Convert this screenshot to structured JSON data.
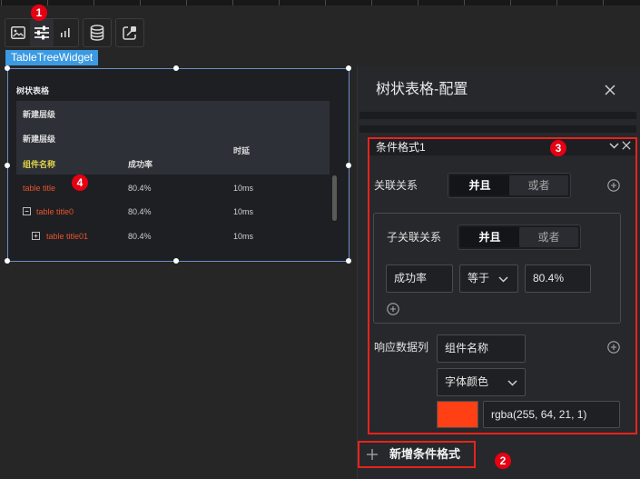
{
  "toolbar": {
    "tools": [
      {
        "icon": "image-icon",
        "active": false
      },
      {
        "icon": "sliders-icon",
        "active": true
      },
      {
        "icon": "bar-chart-icon",
        "active": false
      },
      {
        "icon": "database-icon",
        "active": false
      },
      {
        "icon": "data-link-icon",
        "active": false
      }
    ]
  },
  "markers": [
    "1",
    "2",
    "3",
    "4"
  ],
  "widget": {
    "type_tag": "TableTreeWidget",
    "title": "树状表格",
    "levels": [
      "新建层级",
      "新建层级"
    ],
    "columns": {
      "name": "组件名称",
      "rate": "成功率",
      "latency": "时延"
    },
    "rows": [
      {
        "name": "table title",
        "rate": "80.4%",
        "latency": "10ms",
        "toggle_icon": null
      },
      {
        "name": "table title0",
        "rate": "80.4%",
        "latency": "10ms",
        "toggle_icon": "minus-square-icon"
      },
      {
        "name": "table title01",
        "rate": "80.4%",
        "latency": "10ms",
        "toggle_icon": "plus-square-icon"
      }
    ]
  },
  "panel": {
    "title": "树状表格-配置",
    "condition": {
      "title": "条件格式1",
      "relation": {
        "label": "关联关系",
        "options": [
          {
            "label": "并且",
            "selected": true
          },
          {
            "label": "或者",
            "selected": false
          }
        ]
      },
      "sub_relation": {
        "label": "子关联关系",
        "options": [
          {
            "label": "并且",
            "selected": true
          },
          {
            "label": "或者",
            "selected": false
          }
        ],
        "field": "成功率",
        "operator": "等于",
        "value": "80.4%"
      },
      "response": {
        "label": "响应数据列",
        "column": "组件名称",
        "property": "字体颜色",
        "color_value": "rgba(255, 64, 21, 1)"
      }
    },
    "add_button_label": "新增条件格式"
  },
  "colors": {
    "accent": "#3b9ae1",
    "highlight_text": "#e8532a",
    "column_header_text": "#e3d44a",
    "marker": "#e60012",
    "annotation_border": "#e8231b",
    "swatch": "#ff4015"
  }
}
